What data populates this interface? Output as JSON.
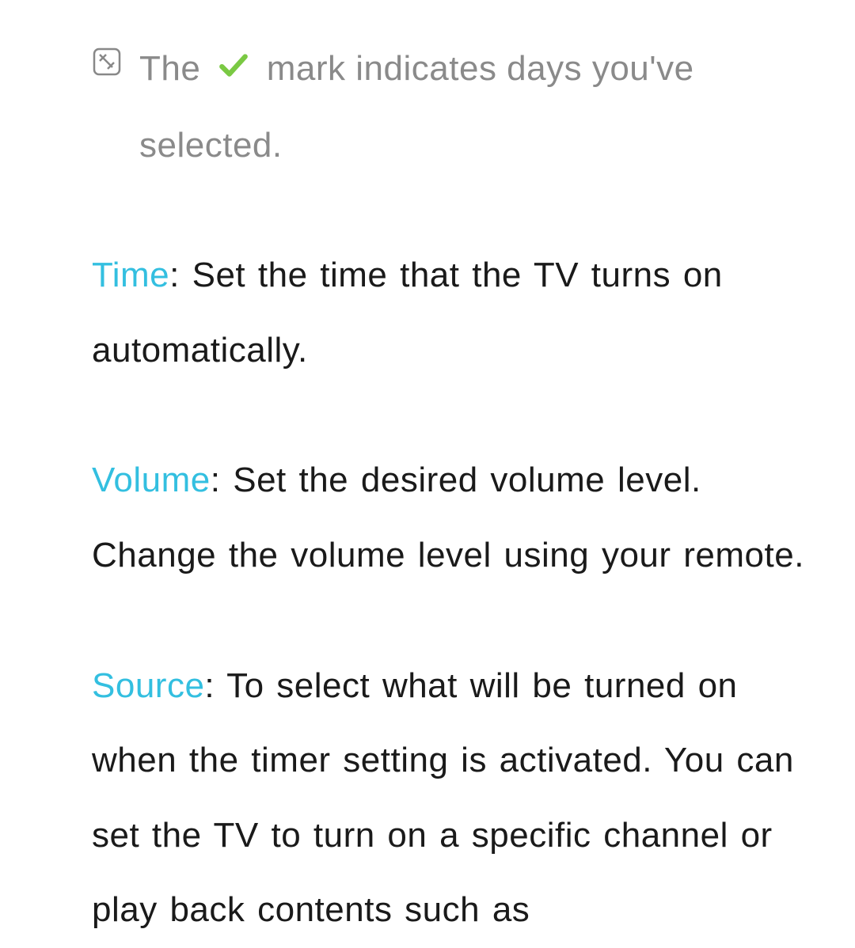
{
  "note": {
    "text_before": "The ",
    "text_after": " mark indicates days you've selected."
  },
  "entries": [
    {
      "label": "Time",
      "desc": ": Set the time that the TV turns on automatically."
    },
    {
      "label": "Volume",
      "desc": ": Set the desired volume level. Change the volume level using your remote."
    },
    {
      "label": "Source",
      "desc": ": To select what will be turned on when the timer setting is activated. You can set the TV to turn on a specific channel or play back contents such as"
    }
  ]
}
